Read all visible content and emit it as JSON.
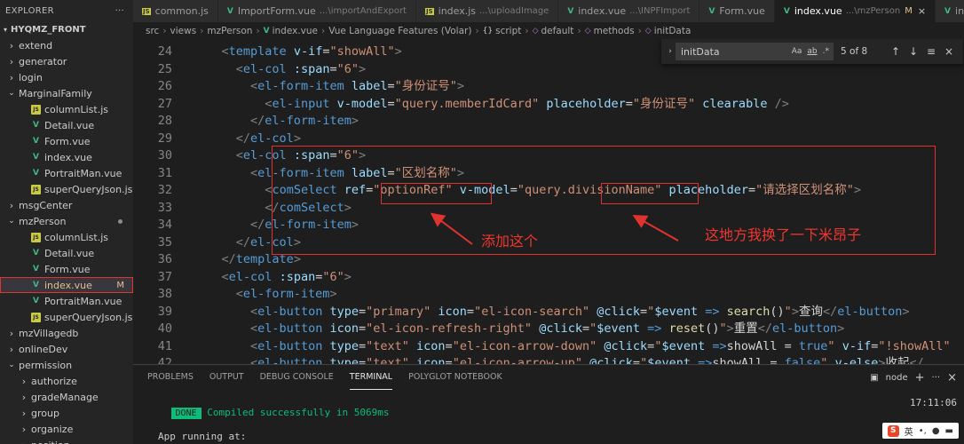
{
  "sidebar": {
    "title": "EXPLORER",
    "menu_glyph": "···",
    "root": "HYQMZ_FRONT",
    "items": [
      {
        "label": "extend",
        "type": "folder",
        "depth": 1,
        "collapsed": true
      },
      {
        "label": "generator",
        "type": "folder",
        "depth": 1,
        "collapsed": true
      },
      {
        "label": "login",
        "type": "folder",
        "depth": 1,
        "collapsed": true
      },
      {
        "label": "MarginalFamily",
        "type": "folder",
        "depth": 1,
        "collapsed": false
      },
      {
        "label": "columnList.js",
        "type": "js",
        "depth": 2
      },
      {
        "label": "Detail.vue",
        "type": "vue",
        "depth": 2
      },
      {
        "label": "Form.vue",
        "type": "vue",
        "depth": 2
      },
      {
        "label": "index.vue",
        "type": "vue",
        "depth": 2
      },
      {
        "label": "PortraitMan.vue",
        "type": "vue",
        "depth": 2
      },
      {
        "label": "superQueryJson.js",
        "type": "js",
        "depth": 2
      },
      {
        "label": "msgCenter",
        "type": "folder",
        "depth": 1,
        "collapsed": true
      },
      {
        "label": "mzPerson",
        "type": "folder",
        "depth": 1,
        "collapsed": false,
        "modified_dot": true
      },
      {
        "label": "columnList.js",
        "type": "js",
        "depth": 2
      },
      {
        "label": "Detail.vue",
        "type": "vue",
        "depth": 2
      },
      {
        "label": "Form.vue",
        "type": "vue",
        "depth": 2
      },
      {
        "label": "index.vue",
        "type": "vue",
        "depth": 2,
        "badge": "M",
        "selected": true
      },
      {
        "label": "PortraitMan.vue",
        "type": "vue",
        "depth": 2
      },
      {
        "label": "superQueryJson.js",
        "type": "js",
        "depth": 2
      },
      {
        "label": "mzVillagedb",
        "type": "folder",
        "depth": 1,
        "collapsed": true
      },
      {
        "label": "onlineDev",
        "type": "folder",
        "depth": 1,
        "collapsed": true
      },
      {
        "label": "permission",
        "type": "folder",
        "depth": 1,
        "collapsed": false
      },
      {
        "label": "authorize",
        "type": "folder",
        "depth": 2,
        "collapsed": true
      },
      {
        "label": "gradeManage",
        "type": "folder",
        "depth": 2,
        "collapsed": true
      },
      {
        "label": "group",
        "type": "folder",
        "depth": 2,
        "collapsed": true
      },
      {
        "label": "organize",
        "type": "folder",
        "depth": 2,
        "collapsed": true
      },
      {
        "label": "position",
        "type": "folder",
        "depth": 2,
        "collapsed": true
      }
    ]
  },
  "tabs": [
    {
      "label": "common.js",
      "type": "js",
      "path": "",
      "active": false
    },
    {
      "label": "ImportForm.vue",
      "type": "vue",
      "path": "...\\importAndExport",
      "active": false
    },
    {
      "label": "index.js",
      "type": "js",
      "path": "...\\uploadImage",
      "active": false
    },
    {
      "label": "index.vue",
      "type": "vue",
      "path": "...\\INPFImport",
      "active": false
    },
    {
      "label": "Form.vue",
      "type": "vue",
      "path": "",
      "active": false
    },
    {
      "label": "index.vue",
      "type": "vue",
      "path": "...\\mzPerson",
      "active": true,
      "badge": "M",
      "close": "×"
    },
    {
      "label": "index",
      "type": "vue",
      "path": "",
      "active": false
    }
  ],
  "breadcrumb": {
    "parts": [
      "src",
      "views",
      "mzPerson",
      "index.vue",
      "Vue Language Features (Volar)",
      "script",
      "default",
      "methods",
      "initData"
    ],
    "sep": "›"
  },
  "find": {
    "value": "initData",
    "opt_case": "Aa",
    "opt_word": "ab",
    "opt_regex": ".*",
    "count": "5 of 8",
    "prev": "↑",
    "next": "↓",
    "menu": "≡",
    "close": "×"
  },
  "code": {
    "line_numbers": [
      "24",
      "25",
      "26",
      "27",
      "28",
      "29",
      "30",
      "31",
      "32",
      "33",
      "34",
      "35",
      "36",
      "37",
      "38",
      "39",
      "40",
      "41",
      "42"
    ],
    "lines": [
      {
        "indent": 4,
        "tokens": [
          [
            "gt",
            "<"
          ],
          [
            "tg",
            "template "
          ],
          [
            "at",
            "v-if"
          ],
          [
            "op",
            "="
          ],
          [
            "st",
            "\"showAll\""
          ],
          [
            "gt",
            ">"
          ]
        ]
      },
      {
        "indent": 6,
        "tokens": [
          [
            "gt",
            "<"
          ],
          [
            "tg",
            "el-col "
          ],
          [
            "at",
            ":span"
          ],
          [
            "op",
            "="
          ],
          [
            "st",
            "\"6\""
          ],
          [
            "gt",
            ">"
          ]
        ]
      },
      {
        "indent": 8,
        "tokens": [
          [
            "gt",
            "<"
          ],
          [
            "tg",
            "el-form-item "
          ],
          [
            "at",
            "label"
          ],
          [
            "op",
            "="
          ],
          [
            "st",
            "\"身份证号\""
          ],
          [
            "gt",
            ">"
          ]
        ]
      },
      {
        "indent": 10,
        "tokens": [
          [
            "gt",
            "<"
          ],
          [
            "tg",
            "el-input "
          ],
          [
            "at",
            "v-model"
          ],
          [
            "op",
            "="
          ],
          [
            "st",
            "\"query.memberIdCard\""
          ],
          [
            "pl",
            " "
          ],
          [
            "at",
            "placeholder"
          ],
          [
            "op",
            "="
          ],
          [
            "st",
            "\"身份证号\""
          ],
          [
            "pl",
            " "
          ],
          [
            "at",
            "clearable"
          ],
          [
            "pl",
            " "
          ],
          [
            "gt",
            "/>"
          ]
        ]
      },
      {
        "indent": 8,
        "tokens": [
          [
            "gt",
            "</"
          ],
          [
            "tg",
            "el-form-item"
          ],
          [
            "gt",
            ">"
          ]
        ]
      },
      {
        "indent": 6,
        "tokens": [
          [
            "gt",
            "</"
          ],
          [
            "tg",
            "el-col"
          ],
          [
            "gt",
            ">"
          ]
        ]
      },
      {
        "indent": 6,
        "tokens": [
          [
            "gt",
            "<"
          ],
          [
            "tg",
            "el-col "
          ],
          [
            "at",
            ":span"
          ],
          [
            "op",
            "="
          ],
          [
            "st",
            "\"6\""
          ],
          [
            "gt",
            ">"
          ]
        ]
      },
      {
        "indent": 8,
        "tokens": [
          [
            "gt",
            "<"
          ],
          [
            "tg",
            "el-form-item "
          ],
          [
            "at",
            "label"
          ],
          [
            "op",
            "="
          ],
          [
            "st",
            "\"区划名称\""
          ],
          [
            "gt",
            ">"
          ]
        ]
      },
      {
        "indent": 10,
        "tokens": [
          [
            "gt",
            "<"
          ],
          [
            "tg",
            "comSelect "
          ],
          [
            "at",
            "ref"
          ],
          [
            "op",
            "="
          ],
          [
            "st",
            "\"optionRef\""
          ],
          [
            "pl",
            " "
          ],
          [
            "at",
            "v-model"
          ],
          [
            "op",
            "="
          ],
          [
            "st",
            "\"query.divisionName\""
          ],
          [
            "pl",
            " "
          ],
          [
            "at",
            "placeholder"
          ],
          [
            "op",
            "="
          ],
          [
            "st",
            "\"请选择区划名称\""
          ],
          [
            "gt",
            ">"
          ]
        ]
      },
      {
        "indent": 10,
        "tokens": [
          [
            "gt",
            "</"
          ],
          [
            "tg",
            "comSelect"
          ],
          [
            "gt",
            ">"
          ]
        ]
      },
      {
        "indent": 8,
        "tokens": [
          [
            "gt",
            "</"
          ],
          [
            "tg",
            "el-form-item"
          ],
          [
            "gt",
            ">"
          ]
        ]
      },
      {
        "indent": 6,
        "tokens": [
          [
            "gt",
            "</"
          ],
          [
            "tg",
            "el-col"
          ],
          [
            "gt",
            ">"
          ]
        ]
      },
      {
        "indent": 4,
        "tokens": [
          [
            "gt",
            "</"
          ],
          [
            "tg",
            "template"
          ],
          [
            "gt",
            ">"
          ]
        ]
      },
      {
        "indent": 4,
        "tokens": [
          [
            "gt",
            "<"
          ],
          [
            "tg",
            "el-col "
          ],
          [
            "at",
            ":span"
          ],
          [
            "op",
            "="
          ],
          [
            "st",
            "\"6\""
          ],
          [
            "gt",
            ">"
          ]
        ]
      },
      {
        "indent": 6,
        "tokens": [
          [
            "gt",
            "<"
          ],
          [
            "tg",
            "el-form-item"
          ],
          [
            "gt",
            ">"
          ]
        ]
      },
      {
        "indent": 8,
        "tokens": [
          [
            "gt",
            "<"
          ],
          [
            "tg",
            "el-button "
          ],
          [
            "at",
            "type"
          ],
          [
            "op",
            "="
          ],
          [
            "st",
            "\"primary\""
          ],
          [
            "pl",
            " "
          ],
          [
            "at",
            "icon"
          ],
          [
            "op",
            "="
          ],
          [
            "st",
            "\"el-icon-search\""
          ],
          [
            "pl",
            " "
          ],
          [
            "at",
            "@click"
          ],
          [
            "op",
            "="
          ],
          [
            "st",
            "\""
          ],
          [
            "at",
            "$event"
          ],
          [
            "kw",
            " =>"
          ],
          [
            "pl",
            " "
          ],
          [
            "fn",
            "search"
          ],
          [
            "pl",
            "()"
          ],
          [
            "st",
            "\""
          ],
          [
            "gt",
            ">"
          ],
          [
            "pl",
            "查询"
          ],
          [
            "gt",
            "</"
          ],
          [
            "tg",
            "el-button"
          ],
          [
            "gt",
            ">"
          ]
        ]
      },
      {
        "indent": 8,
        "tokens": [
          [
            "gt",
            "<"
          ],
          [
            "tg",
            "el-button "
          ],
          [
            "at",
            "icon"
          ],
          [
            "op",
            "="
          ],
          [
            "st",
            "\"el-icon-refresh-right\""
          ],
          [
            "pl",
            " "
          ],
          [
            "at",
            "@click"
          ],
          [
            "op",
            "="
          ],
          [
            "st",
            "\""
          ],
          [
            "at",
            "$event"
          ],
          [
            "kw",
            " =>"
          ],
          [
            "pl",
            " "
          ],
          [
            "fn",
            "reset"
          ],
          [
            "pl",
            "()"
          ],
          [
            "st",
            "\""
          ],
          [
            "gt",
            ">"
          ],
          [
            "pl",
            "重置"
          ],
          [
            "gt",
            "</"
          ],
          [
            "tg",
            "el-button"
          ],
          [
            "gt",
            ">"
          ]
        ]
      },
      {
        "indent": 8,
        "tokens": [
          [
            "gt",
            "<"
          ],
          [
            "tg",
            "el-button "
          ],
          [
            "at",
            "type"
          ],
          [
            "op",
            "="
          ],
          [
            "st",
            "\"text\""
          ],
          [
            "pl",
            " "
          ],
          [
            "at",
            "icon"
          ],
          [
            "op",
            "="
          ],
          [
            "st",
            "\"el-icon-arrow-down\""
          ],
          [
            "pl",
            " "
          ],
          [
            "at",
            "@click"
          ],
          [
            "op",
            "="
          ],
          [
            "st",
            "\""
          ],
          [
            "at",
            "$event"
          ],
          [
            "kw",
            " =>"
          ],
          [
            "pl",
            "showAll = "
          ],
          [
            "kw",
            "true"
          ],
          [
            "st",
            "\""
          ],
          [
            "pl",
            " "
          ],
          [
            "at",
            "v-if"
          ],
          [
            "op",
            "="
          ],
          [
            "st",
            "\"!showAll\""
          ]
        ]
      },
      {
        "indent": 8,
        "tokens": [
          [
            "gt",
            "<"
          ],
          [
            "tg",
            "el-button "
          ],
          [
            "at",
            "type"
          ],
          [
            "op",
            "="
          ],
          [
            "st",
            "\"text\""
          ],
          [
            "pl",
            " "
          ],
          [
            "at",
            "icon"
          ],
          [
            "op",
            "="
          ],
          [
            "st",
            "\"el-icon-arrow-up\""
          ],
          [
            "pl",
            " "
          ],
          [
            "at",
            "@click"
          ],
          [
            "op",
            "="
          ],
          [
            "st",
            "\""
          ],
          [
            "at",
            "$event"
          ],
          [
            "kw",
            " =>"
          ],
          [
            "pl",
            "showAll = "
          ],
          [
            "kw",
            "false"
          ],
          [
            "st",
            "\""
          ],
          [
            "pl",
            " "
          ],
          [
            "at",
            "v-else"
          ],
          [
            "gt",
            ">"
          ],
          [
            "pl",
            "收起"
          ],
          [
            "gt",
            "</"
          ]
        ]
      }
    ]
  },
  "annotations": {
    "add_this": "添加这个",
    "replaced": "这地方我换了一下米昂子"
  },
  "panel": {
    "tabs": [
      "PROBLEMS",
      "OUTPUT",
      "DEBUG CONSOLE",
      "TERMINAL",
      "POLYGLOT NOTEBOOK"
    ],
    "active_tab": "TERMINAL",
    "shell": "node",
    "add": "+",
    "more": "···",
    "close": "×"
  },
  "terminal": {
    "done": "DONE",
    "compiled": "Compiled successfully in 5069ms",
    "time": "17:11:06",
    "running": "App running at:"
  },
  "ime": {
    "logo": "S",
    "lang": "英"
  },
  "colors": {
    "annotation_red": "#e0332f",
    "vue_green": "#41b883",
    "modified_yellow": "#e2c08d",
    "terminal_green": "#0dbc79"
  }
}
